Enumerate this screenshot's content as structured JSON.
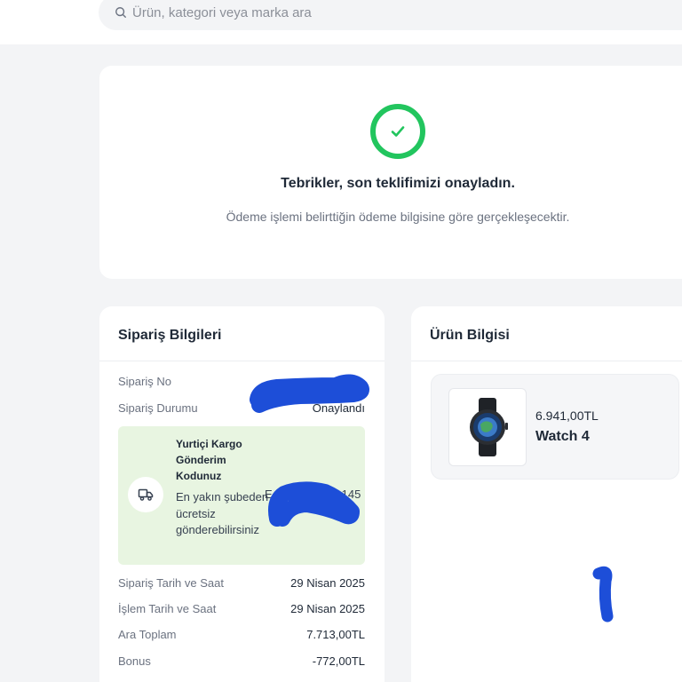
{
  "search": {
    "placeholder": "Ürün, kategori veya marka ara"
  },
  "hero": {
    "title": "Tebrikler, son teklifimizi onayladın.",
    "subtitle": "Ödeme işlemi belirttiğin ödeme bilgisine göre gerçekleşecektir."
  },
  "order": {
    "title": "Sipariş Bilgileri",
    "order_no_label": "Sipariş No",
    "status_label": "Sipariş Durumu",
    "status_value": "Onaylandı",
    "cargo": {
      "title": "Yurtiçi Kargo Gönderim Kodunuz",
      "description": "En yakın şubeden ücretsiz gönderebilirsiniz",
      "code_visible": "E",
      "code_tail": "145"
    },
    "rows": [
      {
        "label": "Sipariş Tarih ve Saat",
        "value": "29 Nisan 2025"
      },
      {
        "label": "İşlem Tarih ve Saat",
        "value": "29 Nisan 2025"
      },
      {
        "label": "Ara Toplam",
        "value": "7.713,00TL"
      },
      {
        "label": "Bonus",
        "value": "-772,00TL"
      }
    ]
  },
  "product": {
    "title": "Ürün Bilgisi",
    "price": "6.941,00TL",
    "name": "Watch 4"
  },
  "colors": {
    "success": "#22c55e",
    "cargo_bg": "#e8f5e1",
    "redaction": "#1d4ed8"
  },
  "icons": [
    "search-icon",
    "check-icon",
    "truck-icon"
  ]
}
